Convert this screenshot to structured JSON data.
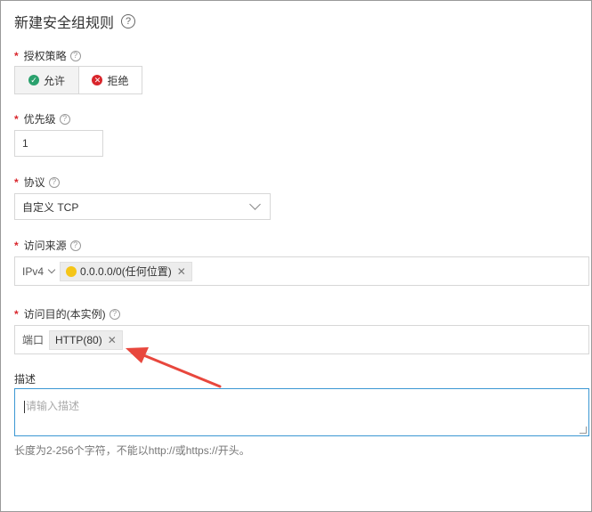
{
  "title": "新建安全组规则",
  "policy": {
    "label": "授权策略",
    "options": [
      {
        "label": "允许",
        "state": "selected",
        "icon": "check-circle-icon"
      },
      {
        "label": "拒绝",
        "state": "unselected",
        "icon": "x-circle-icon"
      }
    ]
  },
  "priority": {
    "label": "优先级",
    "value": "1"
  },
  "protocol": {
    "label": "协议",
    "value": "自定义 TCP"
  },
  "source": {
    "label": "访问来源",
    "ip_version": "IPv4",
    "tag": "0.0.0.0/0(任何位置)"
  },
  "destination": {
    "label": "访问目的(本实例)",
    "prefix": "端口",
    "tag": "HTTP(80)"
  },
  "description": {
    "label": "描述",
    "placeholder": "请输入描述",
    "hint": "长度为2-256个字符，不能以http://或https://开头。"
  },
  "colors": {
    "required_star": "#d9262c",
    "allow_green": "#2aa16d",
    "deny_red": "#d9262c",
    "warning_yellow": "#f5c518",
    "focus_blue": "#3b97d3",
    "annotation_arrow": "#e8473d"
  }
}
